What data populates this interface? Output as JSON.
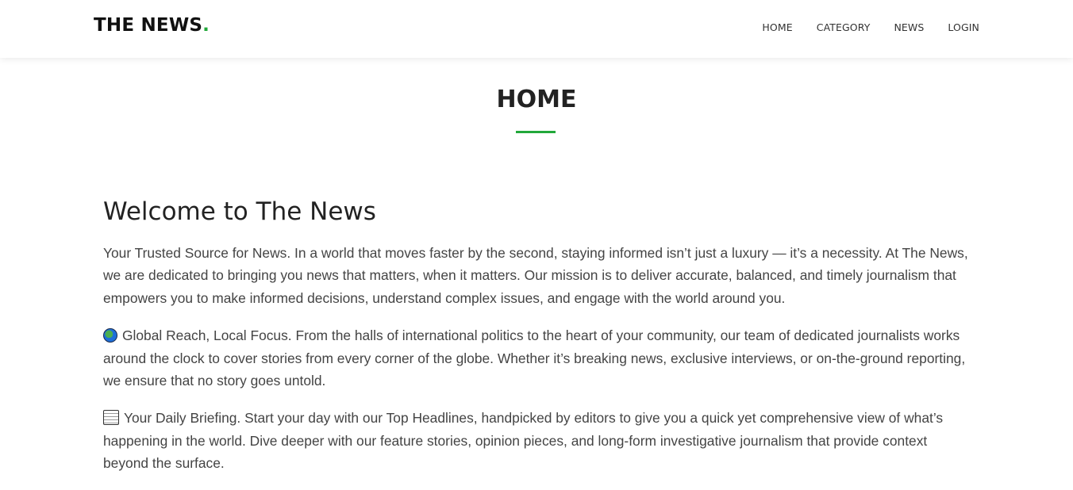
{
  "header": {
    "brand_text": "THE NEWS",
    "brand_dot": ".",
    "nav": [
      "HOME",
      "CATEGORY",
      "NEWS",
      "LOGIN"
    ]
  },
  "page": {
    "heading": "HOME"
  },
  "main": {
    "welcome_title": "Welcome to The News",
    "paragraphs": [
      "Your Trusted Source for News. In a world that moves faster by the second, staying informed isn’t just a luxury — it’s a necessity. At The News, we are dedicated to bringing you news that matters, when it matters. Our mission is to deliver accurate, balanced, and timely journalism that empowers you to make informed decisions, understand complex issues, and engage with the world around you.",
      "Global Reach, Local Focus. From the halls of international politics to the heart of your community, our team of dedicated journalists works around the clock to cover stories from every corner of the globe. Whether it’s breaking news, exclusive interviews, or on-the-ground reporting, we ensure that no story goes untold.",
      "Your Daily Briefing. Start your day with our Top Headlines, handpicked by editors to give you a quick yet comprehensive view of what’s happening in the world. Dive deeper with our feature stories, opinion pieces, and long-form investigative journalism that provide context beyond the surface."
    ],
    "paragraph_icons": [
      "",
      "globe-icon",
      "newspaper-icon"
    ]
  },
  "colors": {
    "accent": "#22a83a",
    "text": "#444444",
    "heading": "#222222"
  }
}
